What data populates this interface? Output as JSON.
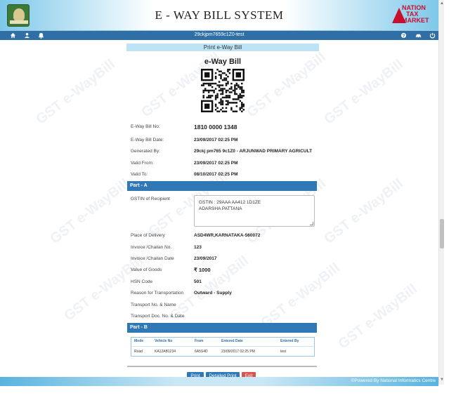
{
  "header": {
    "title": "E - WAY BILL SYSTEM",
    "right_logo_lines": [
      "NATION",
      "TAX",
      "MARKET"
    ]
  },
  "navbar": {
    "user_text": "29ckjpm7659c1Z0-test",
    "left_icons": [
      "home-icon",
      "user-icon",
      "bell-icon"
    ],
    "right_icons": [
      "help-icon",
      "car-icon",
      "power-icon"
    ]
  },
  "print_title": "Print e-Way Bill",
  "bill_heading": "e-Way Bill",
  "watermark": "GST e-WayBill",
  "summary": [
    {
      "label": "E-Way Bill No:",
      "value": "1810 0000 1348"
    },
    {
      "label": "E-Way Bill Date:",
      "value": "23/09/2017 02:25 PM"
    },
    {
      "label": "Generated By:",
      "value": "29ckj pm765 9c1Z0 - ARJUNWAD PRIMARY AGRICULT"
    },
    {
      "label": "Valid From:",
      "value": "23/09/2017 02:25 PM"
    },
    {
      "label": "Valid To:",
      "value": "08/10/2017 02:25 PM"
    }
  ],
  "part_a": {
    "title": "Part - A",
    "gstin_label": "GSTIN of Recipient",
    "gstin_lines": [
      "GSTIN : 29AAA  AA412  1D1ZE",
      "ADARSHA PATTANA"
    ],
    "rows": [
      {
        "label": "Place of Delivery",
        "value": "ASD4WR,KARNATAKA-560072"
      },
      {
        "label": "Invoice /Challan No.",
        "value": "123"
      },
      {
        "label": "Invoice /Challan Date",
        "value": "23/09/2017"
      },
      {
        "label": "Value of Goods",
        "value": "₹ 1000"
      },
      {
        "label": "HSN Code",
        "value": "501"
      },
      {
        "label": "Reason for Transportation",
        "value": "Outward - Supply"
      },
      {
        "label": "Transport No. & Name",
        "value": ""
      },
      {
        "label": "Transport Doc. No. & Date",
        "value": ""
      }
    ]
  },
  "part_b": {
    "title": "Part - B",
    "columns": [
      "Mode",
      "Vehicle No",
      "From",
      "Entered Date",
      "Entered By"
    ],
    "rows": [
      [
        "Road",
        "KA12AB1234",
        "6A5S4D",
        "23/09/2017 02:25 PM",
        "test"
      ]
    ]
  },
  "buttons": {
    "print": "Print",
    "detailed_print": "Detailed Print",
    "exit": "Exit"
  },
  "footer": {
    "text": "©Powered By National Informatics Centre"
  }
}
